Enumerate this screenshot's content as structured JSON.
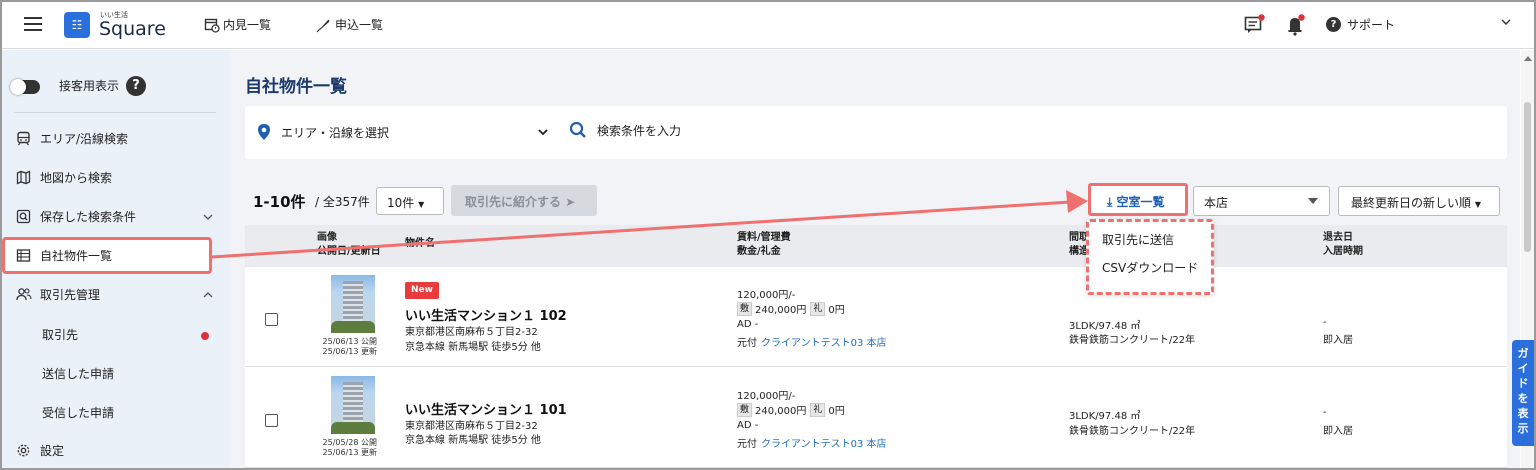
{
  "header": {
    "logo_small": "いい生活",
    "logo_text": "Square",
    "nav": [
      {
        "label": "内見一覧"
      },
      {
        "label": "申込一覧"
      }
    ],
    "support_label": "サポート"
  },
  "sidebar": {
    "toggle_label": "接客用表示",
    "items": [
      {
        "label": "エリア/沿線検索"
      },
      {
        "label": "地図から検索"
      },
      {
        "label": "保存した検索条件"
      },
      {
        "label": "自社物件一覧"
      },
      {
        "label": "取引先管理"
      }
    ],
    "sub_items": [
      {
        "label": "取引先"
      },
      {
        "label": "送信した申請"
      },
      {
        "label": "受信した申請"
      }
    ],
    "settings_label": "設定"
  },
  "main": {
    "title": "自社物件一覧",
    "area_select": "エリア・沿線を選択",
    "keyword_placeholder": "検索条件を入力",
    "count_range": "1-10件",
    "count_total": "/ 全357件",
    "per_page": "10件",
    "intro_button": "取引先に紹介する",
    "vacancy_button": "空室一覧",
    "store_select": "本店",
    "sort_select": "最終更新日の新しい順",
    "dropdown": [
      "取引先に送信",
      "CSVダウンロード"
    ],
    "table_headers": {
      "image": "画像",
      "dates": "公開日/更新日",
      "name": "物件名",
      "rent": "賃料/管理費",
      "deposit": "敷金/礼金",
      "layout": "間取",
      "structure": "構造",
      "past": "退去日",
      "move_in": "入居時期"
    },
    "rows": [
      {
        "badge": "New",
        "published": "25/06/13 公開",
        "updated": "25/06/13 更新",
        "name": "いい生活マンション１ 102",
        "address": "東京都港区南麻布５丁目2-32",
        "station": "京急本線 新馬場駅 徒歩5分 他",
        "rent": "120,000円/-",
        "deposit_tag": "敷",
        "deposit": "240,000円",
        "key_tag": "礼",
        "key_money": "0円",
        "ad": "AD -",
        "owner_prefix": "元付",
        "owner_link": "クライアントテスト03 本店",
        "layout": "3LDK/97.48 ㎡",
        "structure": "鉄骨鉄筋コンクリート/22年",
        "past": "-",
        "move_in": "即入居"
      },
      {
        "badge": "",
        "published": "25/05/28 公開",
        "updated": "25/06/13 更新",
        "name": "いい生活マンション１ 101",
        "address": "東京都港区南麻布５丁目2-32",
        "station": "京急本線 新馬場駅 徒歩5分 他",
        "rent": "120,000円/-",
        "deposit_tag": "敷",
        "deposit": "240,000円",
        "key_tag": "礼",
        "key_money": "0円",
        "ad": "AD -",
        "owner_prefix": "元付",
        "owner_link": "クライアントテスト03 本店",
        "layout": "3LDK/97.48 ㎡",
        "structure": "鉄骨鉄筋コンクリート/22年",
        "past": "-",
        "move_in": "即入居"
      }
    ]
  },
  "guide_tab": "ガイドを表示",
  "colors": {
    "accent": "#2a6fdb",
    "highlight": "#f07070",
    "link": "#1f6fbf",
    "sidebar_bg": "#eaf1f8",
    "badge_red": "#e83b3b"
  }
}
